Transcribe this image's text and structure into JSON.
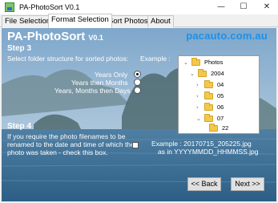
{
  "window": {
    "title": "PA-PhotoSort V0.1"
  },
  "tabs": [
    {
      "label": "File Selection"
    },
    {
      "label": "Format Selection"
    },
    {
      "label": "Sort Photos"
    },
    {
      "label": "About"
    }
  ],
  "header": {
    "app_name": "PA-PhotoSort",
    "version": "V0.1",
    "website": "pacauto.com.au"
  },
  "step3": {
    "heading": "Step 3",
    "instruction": "Select folder structure for sorted photos:",
    "example_label": "Example :",
    "options": [
      {
        "label": "Years Only",
        "selected": true
      },
      {
        "label": "Years then Months",
        "selected": false
      },
      {
        "label": "Years, Months then Days",
        "selected": false
      }
    ]
  },
  "tree": {
    "root": "Photos",
    "year": "2004",
    "months": [
      "04",
      "05",
      "06",
      "07"
    ],
    "day": "22"
  },
  "step4": {
    "heading": "Step 4",
    "text_lines": [
      "If you require the photo filenames to be",
      "renamed to the date and time of which the",
      "photo was taken - check this box."
    ],
    "checked": false,
    "example_line1": "Example : 20170715_205225.jpg",
    "example_line2": "as in  YYYYMMDD_HHMMSS.jpg"
  },
  "buttons": {
    "back": "<< Back",
    "next": "Next >>"
  },
  "colors": {
    "accent": "#1e90e8",
    "sky": "#8fb7d8",
    "sea": "#3d6f9a"
  },
  "icons": {
    "minimize": "minimize-icon",
    "maximize": "maximize-icon",
    "close": "close-icon",
    "folder": "folder-icon"
  }
}
